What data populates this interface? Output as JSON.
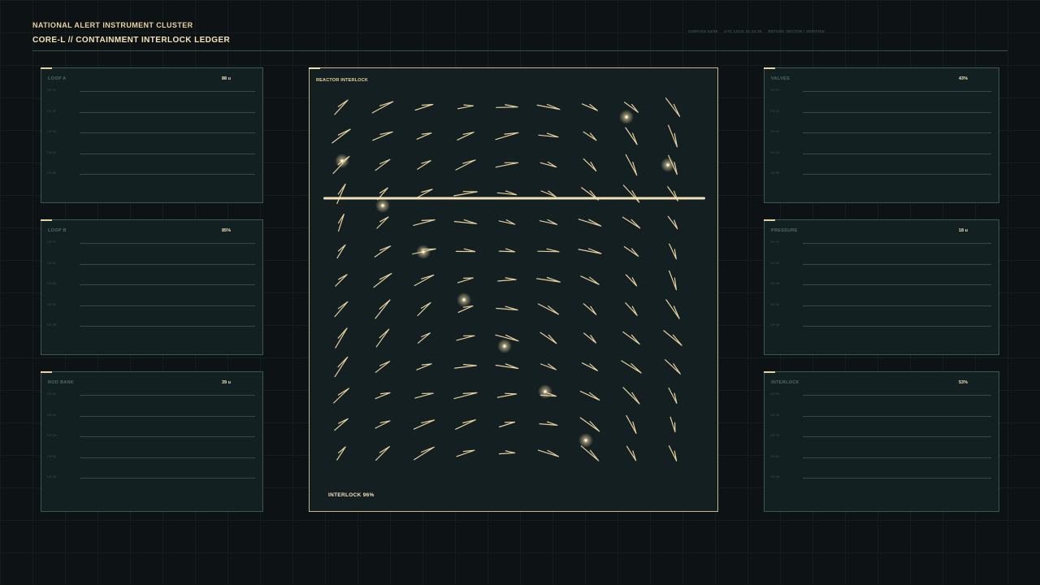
{
  "header": {
    "kicker": "NATIONAL ALERT INSTRUMENT CLUSTER",
    "title": "CORE-L  //  CONTAINMENT INTERLOCK LEDGER",
    "meta": [
      "GIMPASS 63/58",
      "UTC LOCK 21:14:36",
      "REFUSE VECTOR / VERIFIED"
    ]
  },
  "left_panels": [
    {
      "label": "LOOP A",
      "value": "88 u",
      "rows": [
        "CH 01",
        "CH 02",
        "CH 03",
        "CH 04",
        "CH 05"
      ]
    },
    {
      "label": "LOOP B",
      "value": "85%",
      "rows": [
        "CH 01",
        "CH 02",
        "CH 03",
        "CH 04",
        "CH 05"
      ]
    },
    {
      "label": "ROD BANK",
      "value": "39 u",
      "rows": [
        "CH 01",
        "CH 02",
        "CH 03",
        "CH 04",
        "CH 05"
      ]
    }
  ],
  "right_panels": [
    {
      "label": "VALVES",
      "value": "43%",
      "rows": [
        "CH 01",
        "CH 02",
        "CH 03",
        "CH 04",
        "CH 05"
      ]
    },
    {
      "label": "PRESSURE",
      "value": "18 u",
      "rows": [
        "CH 01",
        "CH 02",
        "CH 03",
        "CH 04",
        "CH 05"
      ]
    },
    {
      "label": "INTERLOCK",
      "value": "53%",
      "rows": [
        "CH 01",
        "CH 02",
        "CH 03",
        "CH 04",
        "CH 05"
      ]
    }
  ],
  "center": {
    "label": "REACTOR INTERLOCK",
    "footer": "INTERLOCK 96%",
    "interlock_percent": 96,
    "vector_grid": {
      "columns": 9,
      "rows": 13
    }
  },
  "colors": {
    "background": "#0d1315",
    "panel": "#132022",
    "accent": "#e8d3a2",
    "highlight": "#f3e2b8",
    "panel_border": "#3d5555",
    "muted_text": "#4f6a6a"
  }
}
